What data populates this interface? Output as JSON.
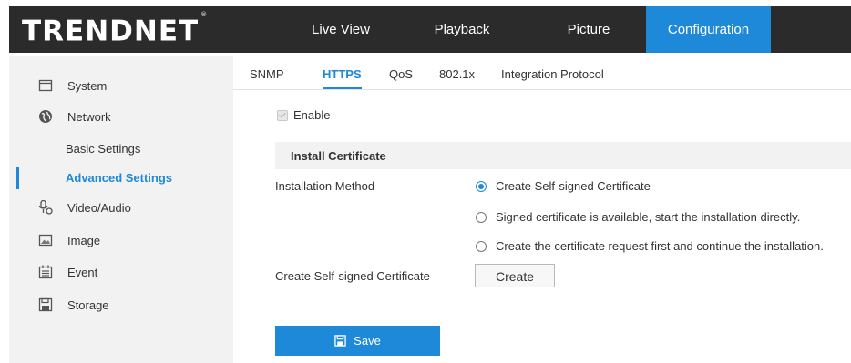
{
  "brand": {
    "logo_text": "TRENDNET",
    "registered_mark": "®"
  },
  "nav": {
    "items": [
      {
        "label": "Live View"
      },
      {
        "label": "Playback"
      },
      {
        "label": "Picture"
      },
      {
        "label": "Configuration",
        "active": true
      }
    ]
  },
  "sidebar": {
    "items": [
      {
        "label": "System",
        "icon": "monitor-icon"
      },
      {
        "label": "Network",
        "icon": "globe-icon"
      },
      {
        "label": "Basic Settings"
      },
      {
        "label": "Advanced Settings",
        "active": true
      },
      {
        "label": "Video/Audio",
        "icon": "video-audio-icon"
      },
      {
        "label": "Image",
        "icon": "image-icon"
      },
      {
        "label": "Event",
        "icon": "event-icon"
      },
      {
        "label": "Storage",
        "icon": "storage-icon"
      }
    ]
  },
  "tabs": [
    {
      "label": "SNMP"
    },
    {
      "label": "HTTPS",
      "active": true
    },
    {
      "label": "QoS"
    },
    {
      "label": "802.1x"
    },
    {
      "label": "Integration Protocol"
    }
  ],
  "form": {
    "enable_label": "Enable",
    "enable_checked": true,
    "section_title": "Install Certificate",
    "installation_method_label": "Installation Method",
    "options": [
      {
        "label": "Create Self-signed Certificate",
        "selected": true
      },
      {
        "label": "Signed certificate is available, start the installation directly.",
        "selected": false
      },
      {
        "label": "Create the certificate request first and continue the installation.",
        "selected": false
      }
    ],
    "create_cert_label": "Create Self-signed Certificate",
    "create_button": "Create",
    "save_button": "Save"
  },
  "colors": {
    "accent": "#1e88d9",
    "topbar": "#2b2b2b",
    "sidebar": "#f2f2f2"
  }
}
